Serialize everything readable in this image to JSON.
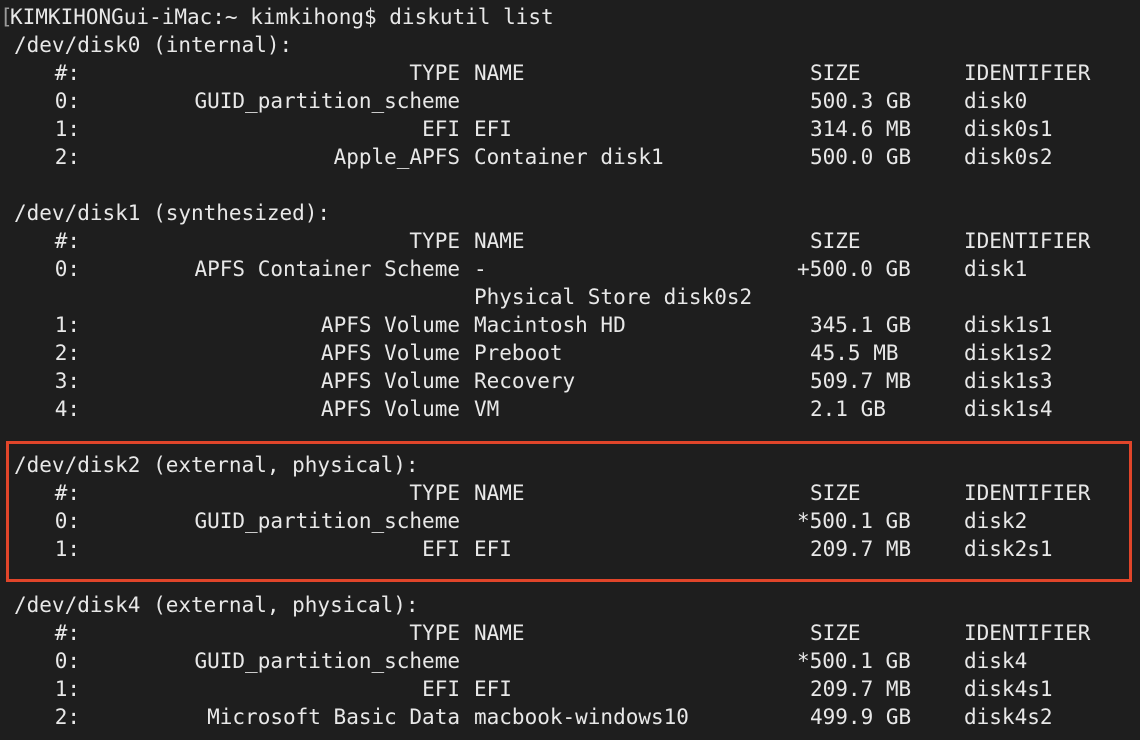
{
  "prompt": {
    "bracket": "[",
    "text": "KIMKIHONGui-iMac:~ kimkihong$ diskutil list"
  },
  "header": {
    "num": "#:",
    "type": "TYPE",
    "name": "NAME",
    "size": "SIZE",
    "identifier": "IDENTIFIER"
  },
  "highlight": {
    "color": "#e0452a",
    "disk": "/dev/disk2"
  },
  "disks": [
    {
      "title": "/dev/disk0 (internal):",
      "rows": [
        {
          "num": "0:",
          "type": "GUID_partition_scheme",
          "name": "",
          "size": "500.3 GB",
          "identifier": "disk0"
        },
        {
          "num": "1:",
          "type": "EFI",
          "name": "EFI",
          "size": "314.6 MB",
          "identifier": "disk0s1"
        },
        {
          "num": "2:",
          "type": "Apple_APFS",
          "name": "Container disk1",
          "size": "500.0 GB",
          "identifier": "disk0s2"
        }
      ]
    },
    {
      "title": "/dev/disk1 (synthesized):",
      "rows": [
        {
          "num": "0:",
          "type": "APFS Container Scheme",
          "name": "-",
          "size": "+500.0 GB",
          "identifier": "disk1",
          "continuation": "Physical Store disk0s2"
        },
        {
          "num": "1:",
          "type": "APFS Volume",
          "name": "Macintosh HD",
          "size": "345.1 GB",
          "identifier": "disk1s1"
        },
        {
          "num": "2:",
          "type": "APFS Volume",
          "name": "Preboot",
          "size": "45.5 MB",
          "identifier": "disk1s2"
        },
        {
          "num": "3:",
          "type": "APFS Volume",
          "name": "Recovery",
          "size": "509.7 MB",
          "identifier": "disk1s3"
        },
        {
          "num": "4:",
          "type": "APFS Volume",
          "name": "VM",
          "size": "2.1 GB",
          "identifier": "disk1s4"
        }
      ]
    },
    {
      "title": "/dev/disk2 (external, physical):",
      "rows": [
        {
          "num": "0:",
          "type": "GUID_partition_scheme",
          "name": "",
          "size": "*500.1 GB",
          "identifier": "disk2"
        },
        {
          "num": "1:",
          "type": "EFI",
          "name": "EFI",
          "size": "209.7 MB",
          "identifier": "disk2s1"
        }
      ]
    },
    {
      "title": "/dev/disk4 (external, physical):",
      "rows": [
        {
          "num": "0:",
          "type": "GUID_partition_scheme",
          "name": "",
          "size": "*500.1 GB",
          "identifier": "disk4"
        },
        {
          "num": "1:",
          "type": "EFI",
          "name": "EFI",
          "size": "209.7 MB",
          "identifier": "disk4s1"
        },
        {
          "num": "2:",
          "type": "Microsoft Basic Data",
          "name": "macbook-windows10",
          "size": "499.9 GB",
          "identifier": "disk4s2"
        }
      ]
    }
  ]
}
